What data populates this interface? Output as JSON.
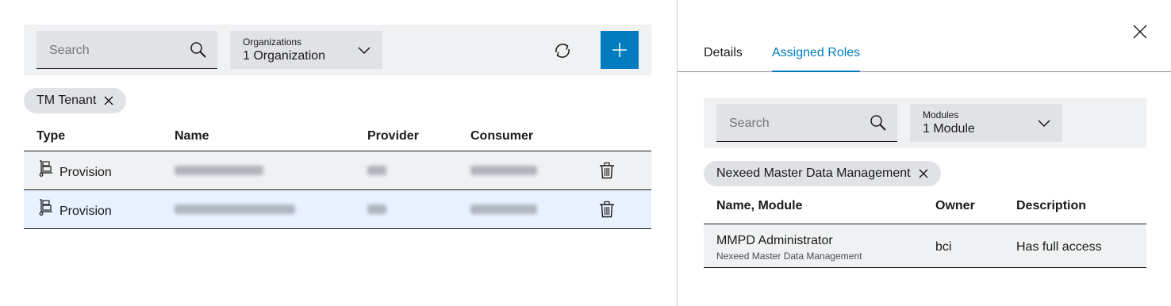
{
  "left": {
    "search": {
      "placeholder": "Search"
    },
    "organizations": {
      "label": "Organizations",
      "value": "1 Organization"
    },
    "filter_chip": "TM Tenant",
    "columns": [
      "Type",
      "Name",
      "Provider",
      "Consumer"
    ],
    "rows": [
      {
        "type": "Provision",
        "selected": false
      },
      {
        "type": "Provision",
        "selected": true
      }
    ]
  },
  "right": {
    "tabs": [
      {
        "label": "Details",
        "active": false
      },
      {
        "label": "Assigned Roles",
        "active": true
      }
    ],
    "search": {
      "placeholder": "Search"
    },
    "modules": {
      "label": "Modules",
      "value": "1 Module"
    },
    "filter_chip": "Nexeed Master Data Management",
    "columns": [
      "Name, Module",
      "Owner",
      "Description"
    ],
    "rows": [
      {
        "name": "MMPD Administrator",
        "module": "Nexeed Master Data Management",
        "owner": "bci",
        "description": "Has full access"
      }
    ]
  },
  "icons": {
    "search": "search-icon",
    "chevron": "chevron-down-icon",
    "refresh": "refresh-icon",
    "add": "add-icon",
    "close": "close-icon",
    "delete": "trash-icon",
    "type": "hand-truck-icon"
  },
  "colors": {
    "accent": "#007bc0",
    "selected_row": "#e8f1ff",
    "toolbar_bg": "#eff1f2",
    "field_bg": "#e0e2e5"
  }
}
